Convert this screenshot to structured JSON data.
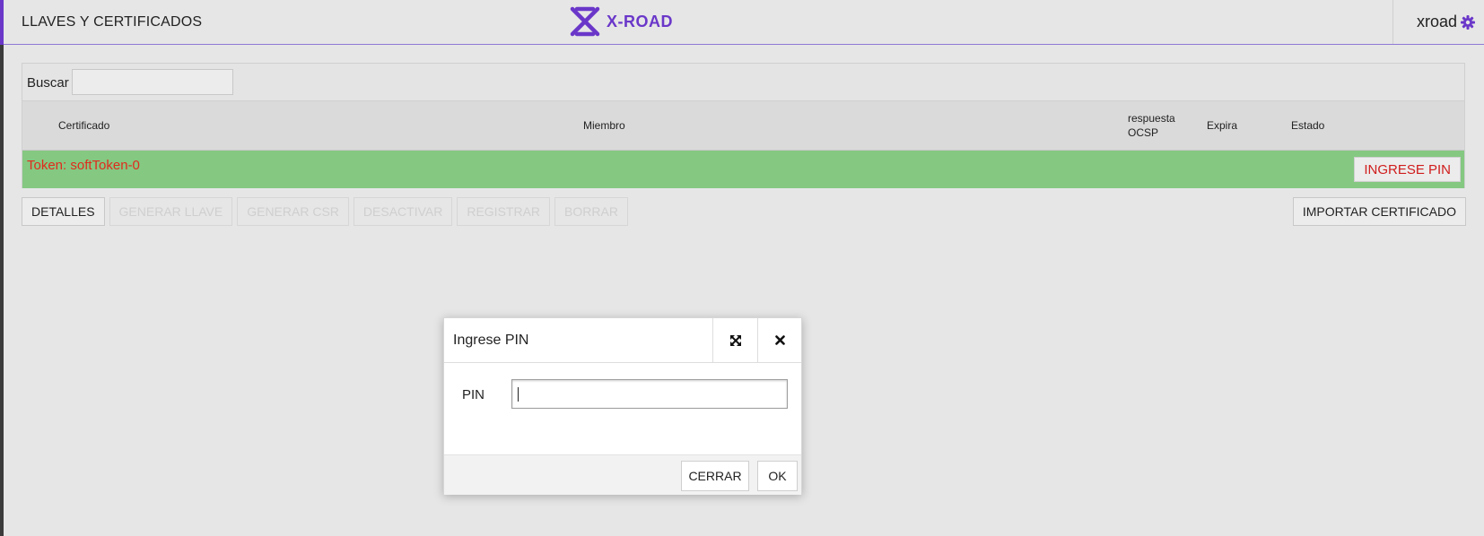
{
  "header": {
    "page_title": "LLAVES Y CERTIFICADOS",
    "logo_text": "X-ROAD",
    "username": "xroad",
    "brand_color": "#6a37c9"
  },
  "search": {
    "label": "Buscar",
    "value": ""
  },
  "table": {
    "columns": [
      "Certificado",
      "Miembro",
      "respuesta OCSP",
      "Expira",
      "Estado"
    ],
    "token_label": "Token: softToken-0",
    "token_row_color": "#85c882",
    "token_action": "INGRESE PIN"
  },
  "actions": {
    "details": "DETALLES",
    "generate_key": "GENERAR LLAVE",
    "generate_csr": "GENERAR CSR",
    "deactivate": "DESACTIVAR",
    "register": "REGISTRAR",
    "delete": "BORRAR",
    "import_certificate": "IMPORTAR CERTIFICADO"
  },
  "dialog": {
    "title": "Ingrese PIN",
    "pin_label": "PIN",
    "pin_value": "",
    "close_label": "CERRAR",
    "ok_label": "OK"
  }
}
